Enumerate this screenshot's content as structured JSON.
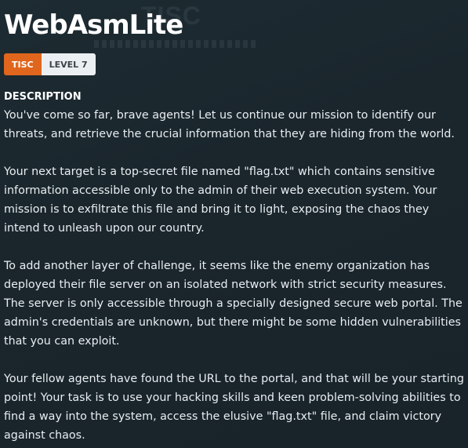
{
  "challenge": {
    "title": "WebAsmLite",
    "tags": {
      "event": "TISC",
      "level": "LEVEL 7"
    },
    "description_heading": "DESCRIPTION",
    "paragraphs": [
      "You've come so far, brave agents! Let us continue our mission to identify our threats, and retrieve the crucial information that they are hiding from the world.",
      "Your next target is a top-secret file named \"flag.txt\" which contains sensitive information accessible only to the admin of their web execution system. Your mission is to exfiltrate this file and bring it to light, exposing the chaos they intend to unleash upon our country.",
      "To add another layer of challenge, it seems like the enemy organization has deployed their file server on an isolated network with strict security measures. The server is only accessible through a specially designed secure web portal. The admin's credentials are unknown, but there might be some hidden vulnerabilities that you can exploit.",
      "Your fellow agents have found the URL to the portal, and that will be your starting point! Your task is to use your hacking skills and keen problem-solving abilities to find a way into the system, access the elusive \"flag.txt\" file, and claim victory against chaos."
    ]
  },
  "colors": {
    "background": "#1b272e",
    "event_tag": "#e0661d",
    "level_tag": "#eceff1",
    "text": "#e9eef1"
  }
}
